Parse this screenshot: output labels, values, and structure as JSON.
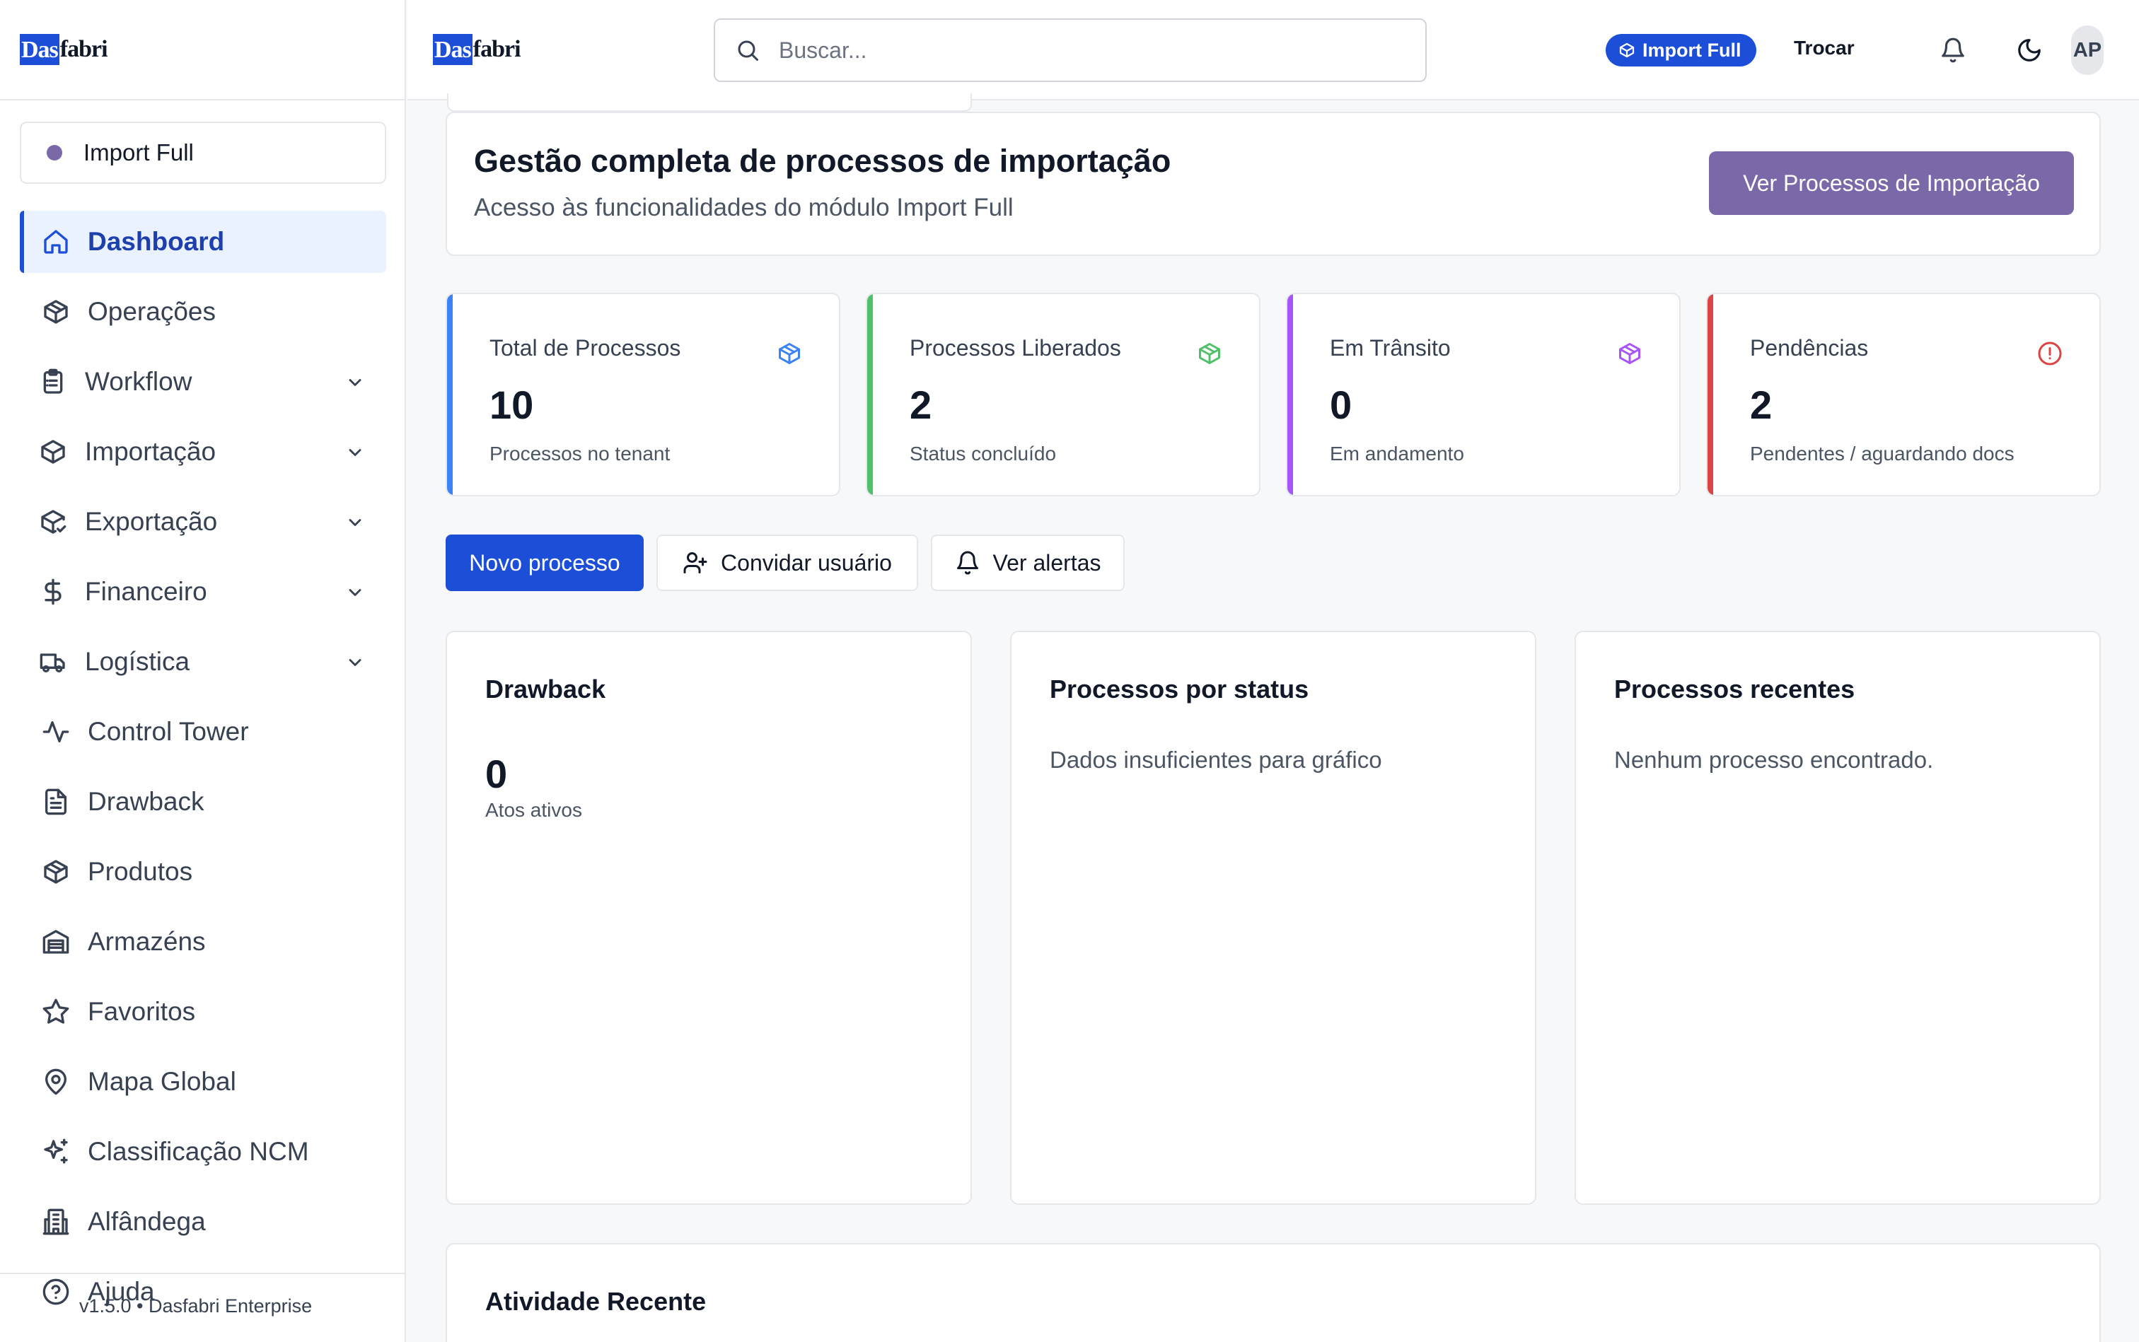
{
  "brand": {
    "logo_box": "Das",
    "logo_rest": "fabri"
  },
  "sidebar": {
    "module": "Import Full",
    "items": [
      {
        "label": "Dashboard",
        "icon": "home-icon",
        "active": true,
        "group": false
      },
      {
        "label": "Operações",
        "icon": "package-icon",
        "active": false,
        "group": false
      },
      {
        "label": "Workflow",
        "icon": "clipboard-list-icon",
        "active": false,
        "group": true
      },
      {
        "label": "Importação",
        "icon": "package-import-icon",
        "active": false,
        "group": true
      },
      {
        "label": "Exportação",
        "icon": "package-check-icon",
        "active": false,
        "group": true
      },
      {
        "label": "Financeiro",
        "icon": "dollar-icon",
        "active": false,
        "group": true
      },
      {
        "label": "Logística",
        "icon": "truck-icon",
        "active": false,
        "group": true
      },
      {
        "label": "Control Tower",
        "icon": "activity-icon",
        "active": false,
        "group": false
      },
      {
        "label": "Drawback",
        "icon": "file-text-icon",
        "active": false,
        "group": false
      },
      {
        "label": "Produtos",
        "icon": "package-icon",
        "active": false,
        "group": false
      },
      {
        "label": "Armazéns",
        "icon": "warehouse-icon",
        "active": false,
        "group": false
      },
      {
        "label": "Favoritos",
        "icon": "star-icon",
        "active": false,
        "group": false
      },
      {
        "label": "Mapa Global",
        "icon": "map-pin-icon",
        "active": false,
        "group": false
      },
      {
        "label": "Classificação NCM",
        "icon": "sparkles-icon",
        "active": false,
        "group": false
      },
      {
        "label": "Alfândega",
        "icon": "building-icon",
        "active": false,
        "group": false
      },
      {
        "label": "Ajuda",
        "icon": "help-circle-icon",
        "active": false,
        "group": false
      }
    ],
    "version": "v1.5.0 • Dasfabri Enterprise"
  },
  "topbar": {
    "search_placeholder": "Buscar...",
    "module_badge": "Import Full",
    "switch_label": "Trocar",
    "avatar_initials": "AP"
  },
  "hero": {
    "title": "Gestão completa de processos de importação",
    "subtitle": "Acesso às funcionalidades do módulo Import Full",
    "button": "Ver Processos de Importação"
  },
  "stats": [
    {
      "title": "Total de Processos",
      "value": "10",
      "desc": "Processos no tenant",
      "color": "#3b82f6"
    },
    {
      "title": "Processos Liberados",
      "value": "2",
      "desc": "Status concluído",
      "color": "#52c06a"
    },
    {
      "title": "Em Trânsito",
      "value": "0",
      "desc": "Em andamento",
      "color": "#a855f7"
    },
    {
      "title": "Pendências",
      "value": "2",
      "desc": "Pendentes / aguardando docs",
      "color": "#dc4444"
    }
  ],
  "actions": {
    "new_process": "Novo processo",
    "invite_user": "Convidar usuário",
    "view_alerts": "Ver alertas"
  },
  "panels": {
    "drawback": {
      "title": "Drawback",
      "value": "0",
      "sub": "Atos ativos"
    },
    "status": {
      "title": "Processos por status",
      "text": "Dados insuficientes para gráfico"
    },
    "recent": {
      "title": "Processos recentes",
      "text": "Nenhum processo encontrado."
    }
  },
  "activity": {
    "title": "Atividade Recente"
  },
  "colors": {
    "accent": "#1d4ed8",
    "brand_purple": "#7b68a8",
    "active_bg": "#eaf2ff"
  }
}
